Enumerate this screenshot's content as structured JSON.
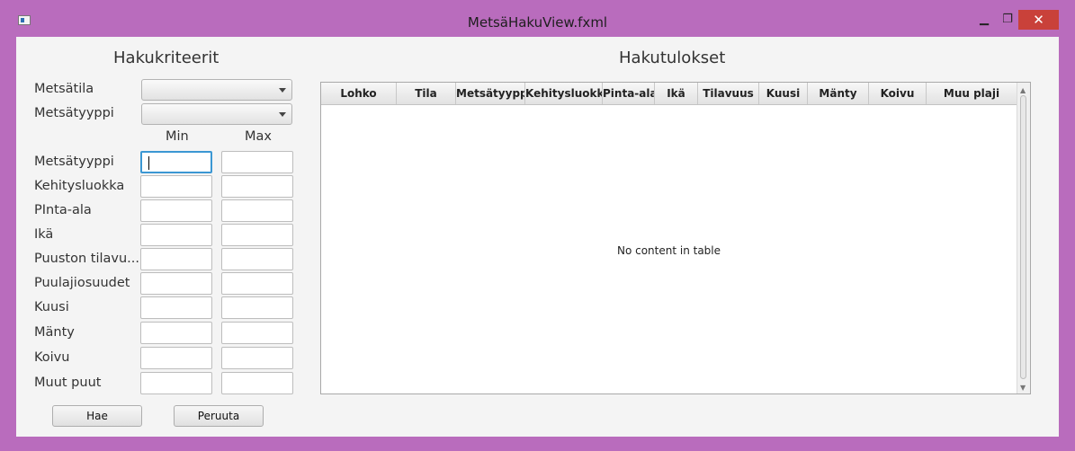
{
  "window": {
    "title": "MetsäHakuView.fxml",
    "minimize_glyph": "▁",
    "maximize_glyph": "❐",
    "close_glyph": "✕",
    "app_icon": "window-app-icon",
    "accent_color": "#b96cbd"
  },
  "criteria": {
    "heading": "Hakukriteerit",
    "combos": [
      {
        "label": "Metsätila",
        "value": ""
      },
      {
        "label": "Metsätyyppi",
        "value": ""
      }
    ],
    "min_header": "Min",
    "max_header": "Max",
    "ranges": [
      {
        "label": "Metsätyyppi",
        "min": "",
        "max": ""
      },
      {
        "label": "Kehitysluokka",
        "min": "",
        "max": ""
      },
      {
        "label": "PInta-ala",
        "min": "",
        "max": ""
      },
      {
        "label": "Ikä",
        "min": "",
        "max": ""
      },
      {
        "label": "Puuston tilavu...",
        "min": "",
        "max": ""
      },
      {
        "label": "Puulajiosuudet",
        "min": "",
        "max": ""
      },
      {
        "label": "Kuusi",
        "min": "",
        "max": ""
      },
      {
        "label": "Mänty",
        "min": "",
        "max": ""
      },
      {
        "label": "Koivu",
        "min": "",
        "max": ""
      },
      {
        "label": "Muut puut",
        "min": "",
        "max": ""
      }
    ],
    "search_button": "Hae",
    "cancel_button": "Peruuta"
  },
  "results": {
    "heading": "Hakutulokset",
    "columns": [
      "Lohko",
      "Tila",
      "Metsätyyppi",
      "Kehitysluokka",
      "Pinta-ala",
      "Ikä",
      "Tilavuus",
      "Kuusi",
      "Mänty",
      "Koivu",
      "Muu plaji"
    ],
    "empty_text": "No content in table",
    "rows": []
  }
}
